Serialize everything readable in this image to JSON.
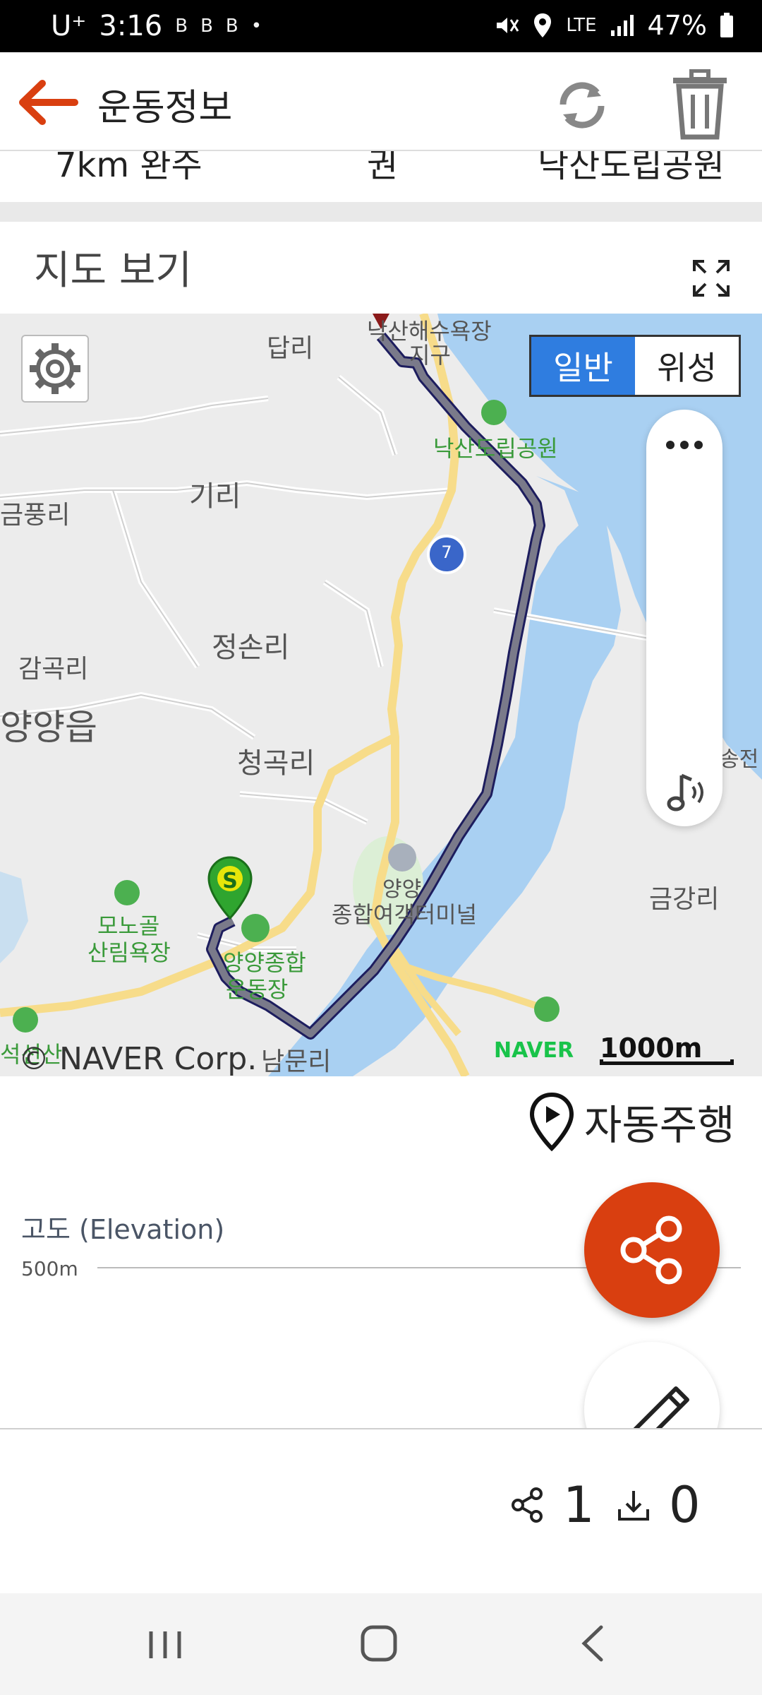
{
  "status_bar": {
    "carrier": "U⁺",
    "time": "3:16",
    "app_badges": [
      "B",
      "B",
      "B"
    ],
    "network": "LTE",
    "battery": "47%"
  },
  "header": {
    "title": "운동정보"
  },
  "summary_row": {
    "col1": "7km 완주",
    "col2": "권",
    "col3": "낙산도립공원"
  },
  "map_section": {
    "title": "지도 보기",
    "map_type": {
      "normal": "일반",
      "satellite": "위성",
      "selected": "일반"
    },
    "labels": {
      "dari": "답리",
      "naksan_beach": "낙산해수욕장",
      "district": "지구",
      "naksan_park": "낙산도립공원",
      "geumpung": "금풍리",
      "giri": "기리",
      "route_no": "7",
      "jeongson": "정손리",
      "gamgok": "감곡리",
      "yangyang_eup": "양양읍",
      "songjeon": "송전",
      "cheonggok": "청곡리",
      "yangyang": "양양",
      "terminal": "종합여객터미널",
      "geumgang": "금강리",
      "monogol_1": "모노골",
      "monogol_2": "산림욕장",
      "stadium_1": "양양종합",
      "stadium_2": "운동장",
      "namun": "남문리",
      "seokseon": "석선산"
    },
    "start_marker": "S",
    "provider": "NAVER",
    "scale": "1000m",
    "copyright": "© NAVER Corp."
  },
  "auto_drive": {
    "label": "자동주행"
  },
  "elevation": {
    "title": "고도 (Elevation)",
    "tick_label": "500m"
  },
  "stats": {
    "share_count": "1",
    "download_count": "0"
  },
  "icons": {
    "back": "arrow-left",
    "refresh": "refresh",
    "delete": "trash",
    "fullscreen": "expand",
    "settings": "gear",
    "more": "ellipsis",
    "music": "music-note",
    "share": "share",
    "edit": "pencil",
    "download": "download"
  },
  "colors": {
    "accent": "#d93f10",
    "map_selected": "#2f7de0",
    "route": "#7a7a8a",
    "start_marker": "#2fa52f"
  }
}
